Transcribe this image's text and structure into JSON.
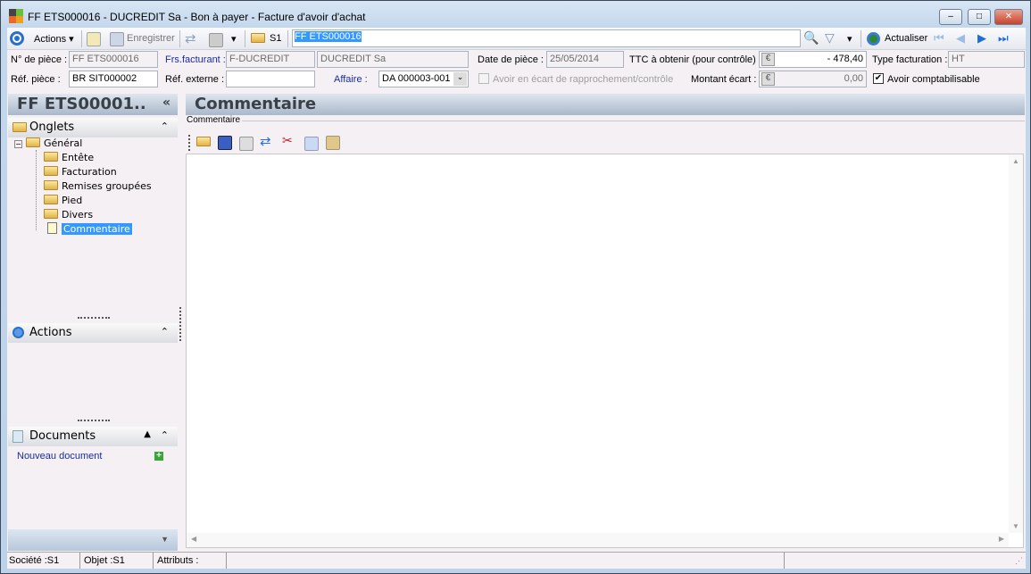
{
  "window": {
    "title": "FF ETS000016 - DUCREDIT  Sa - Bon à payer -  Facture d'avoir d'achat",
    "minimize": "–",
    "maximize": "□",
    "close": "✕"
  },
  "toolbar": {
    "actions": "Actions",
    "save": "Enregistrer",
    "company": "S1",
    "search_value": "FF ETS000016",
    "refresh": "Actualiser"
  },
  "fields": {
    "num_piece_label": "N° de pièce :",
    "num_piece": "FF ETS000016",
    "frs_label": "Frs.facturant :",
    "frs_code": "F-DUCREDIT",
    "frs_name": "DUCREDIT  Sa",
    "date_label": "Date de pièce :",
    "date": "25/05/2014",
    "ttc_label": "TTC à obtenir (pour contrôle) :",
    "ttc": "- 478,40",
    "currency": "€",
    "type_label": "Type facturation :",
    "type": "HT",
    "ref_piece_label": "Réf. pièce :",
    "ref_piece": "BR SIT000002",
    "ref_ext_label": "Réf. externe :",
    "ref_ext": "",
    "affaire_label": "Affaire :",
    "affaire": "DA 000003-001",
    "ecart_check_label": "Avoir en écart de rapprochement/contrôle",
    "montant_label": "Montant écart :",
    "montant": "0,00",
    "compta_label": "Avoir comptabilisable"
  },
  "left": {
    "header": "FF ETS00001..",
    "onglets": "Onglets",
    "tree": [
      "Général",
      "Entête",
      "Facturation",
      "Remises groupées",
      "Pied",
      "Divers",
      "Commentaire"
    ],
    "actions": "Actions",
    "documents": "Documents",
    "new_doc": "Nouveau document"
  },
  "main": {
    "header": "Commentaire",
    "group": "Commentaire"
  },
  "status": {
    "societe": "Société :S1",
    "objet": "Objet :S1",
    "attributs": "Attributs :"
  }
}
